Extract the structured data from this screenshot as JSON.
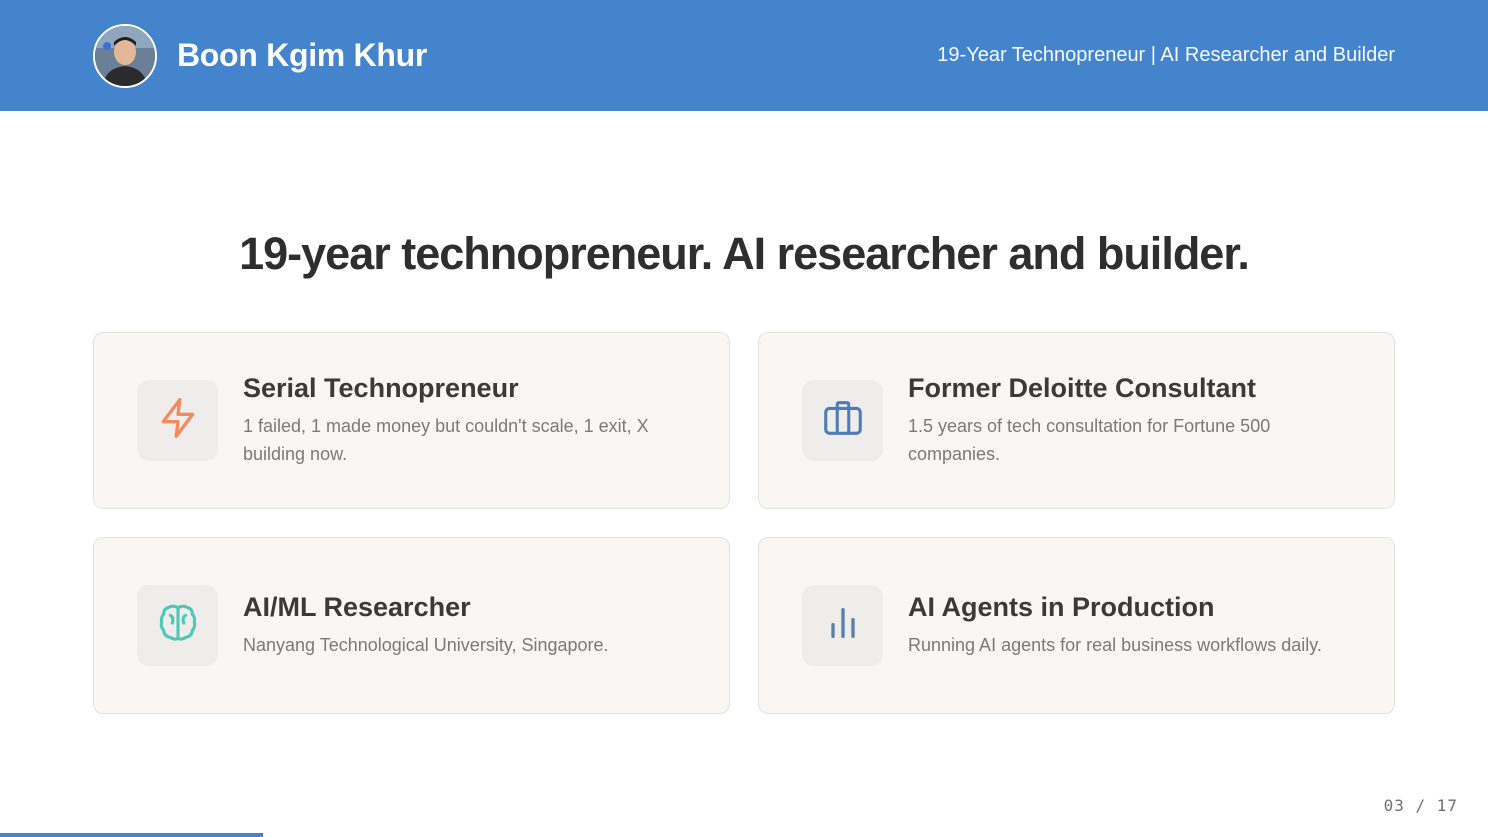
{
  "header": {
    "name": "Boon Kgim Khur",
    "tagline": "19-Year Technopreneur | AI Researcher and Builder"
  },
  "headline": "19-year technopreneur. AI researcher and builder.",
  "cards": [
    {
      "title": "Serial Technopreneur",
      "description": "1 failed, 1 made money but couldn't scale, 1 exit, X building now.",
      "icon": "lightning-icon",
      "icon_color": "#f28a5c"
    },
    {
      "title": "Former Deloitte Consultant",
      "description": "1.5 years of tech consultation for Fortune 500 companies.",
      "icon": "briefcase-icon",
      "icon_color": "#4f7cb3"
    },
    {
      "title": "AI/ML Researcher",
      "description": "Nanyang Technological University, Singapore.",
      "icon": "brain-icon",
      "icon_color": "#4cc9b3"
    },
    {
      "title": "AI Agents in Production",
      "description": "Running AI agents for real business workflows daily.",
      "icon": "bar-chart-icon",
      "icon_color": "#5b7fa8"
    }
  ],
  "pagination": {
    "label": "03 / 17",
    "progress_fraction": 0.1765
  },
  "colors": {
    "accent": "#4384cc",
    "card_background": "#f8f7f6"
  }
}
